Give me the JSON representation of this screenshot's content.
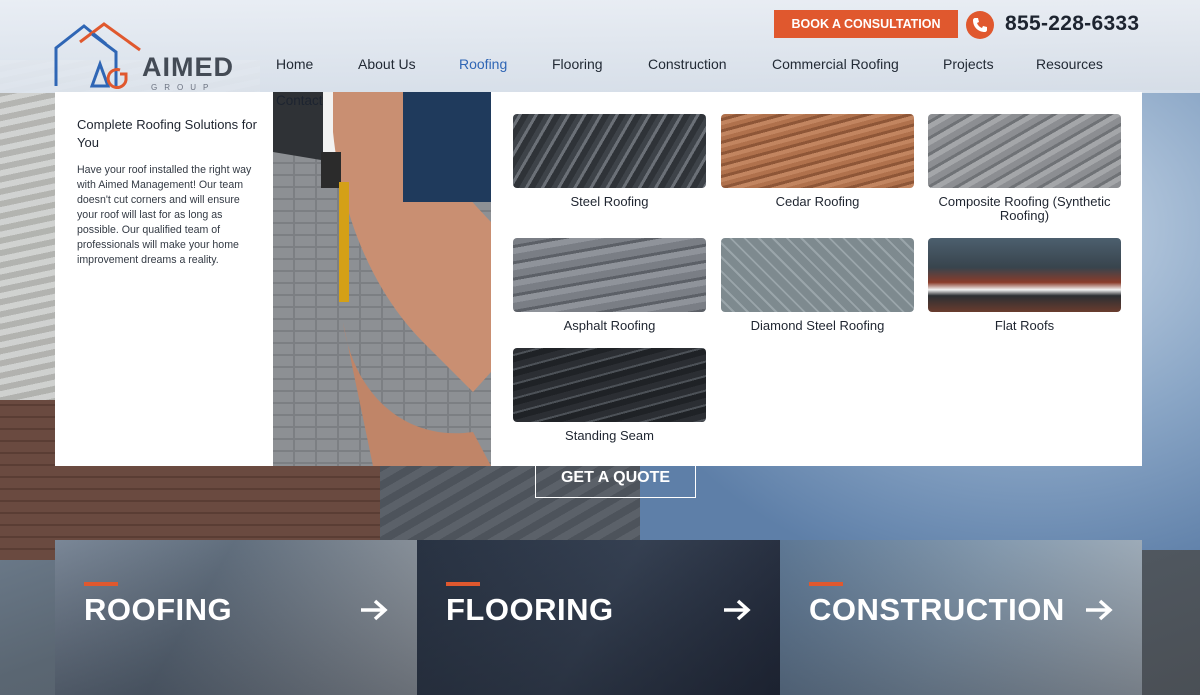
{
  "brand": {
    "name": "AIMED",
    "sub": "GROUP",
    "colors": {
      "accent": "#e0582e",
      "blue": "#2f66b5",
      "dark": "#1d2430"
    }
  },
  "header": {
    "consult_label": "BOOK A CONSULTATION",
    "phone": "855-228-6333",
    "nav": [
      {
        "label": "Home"
      },
      {
        "label": "About Us"
      },
      {
        "label": "Roofing",
        "active": true
      },
      {
        "label": "Flooring"
      },
      {
        "label": "Construction"
      },
      {
        "label": "Commercial Roofing"
      },
      {
        "label": "Projects"
      },
      {
        "label": "Resources"
      },
      {
        "label": "Contact"
      }
    ]
  },
  "mega_menu": {
    "title": "Complete Roofing Solutions for You",
    "description": "Have your roof installed the right way with Aimed Management! Our team doesn't cut corners and will ensure your roof will last for as long as possible. Our qualified team of professionals will make your home improvement dreams a reality.",
    "items": [
      {
        "label": "Steel Roofing",
        "icon": "steel-roof-photo"
      },
      {
        "label": "Cedar Roofing",
        "icon": "cedar-roof-photo"
      },
      {
        "label": "Composite Roofing (Synthetic Roofing)",
        "icon": "composite-roof-photo"
      },
      {
        "label": "Asphalt Roofing",
        "icon": "asphalt-roof-photo"
      },
      {
        "label": "Diamond Steel Roofing",
        "icon": "diamond-steel-roof-photo"
      },
      {
        "label": "Flat Roofs",
        "icon": "flat-roof-photo"
      },
      {
        "label": "Standing Seam",
        "icon": "standing-seam-roof-photo"
      }
    ]
  },
  "hero": {
    "quote_label": "GET A QUOTE"
  },
  "cards": [
    {
      "title": "ROOFING"
    },
    {
      "title": "FLOORING"
    },
    {
      "title": "CONSTRUCTION"
    }
  ]
}
